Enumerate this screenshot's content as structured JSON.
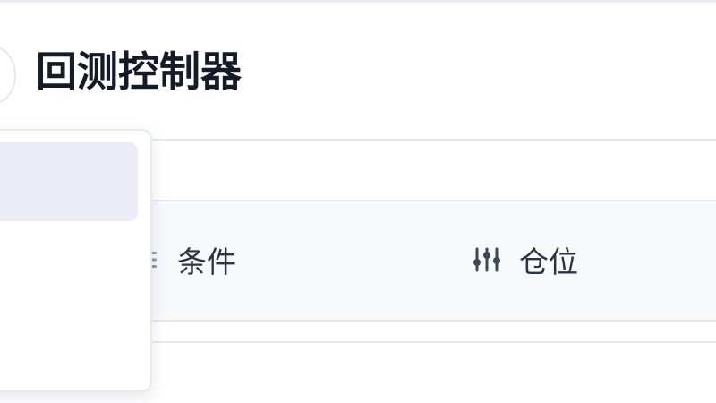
{
  "header": {
    "title": "回测控制器"
  },
  "tabs": [
    {
      "label": "条件",
      "icon": "list-filter-icon"
    },
    {
      "label": "仓位",
      "icon": "sliders-icon"
    }
  ],
  "colors": {
    "title": "#151b26",
    "tab_text": "#2c3443",
    "tab_bg": "#f7f9fb",
    "divider": "#e4e9f0",
    "dropdown_selected_bg": "#ecebf8"
  }
}
